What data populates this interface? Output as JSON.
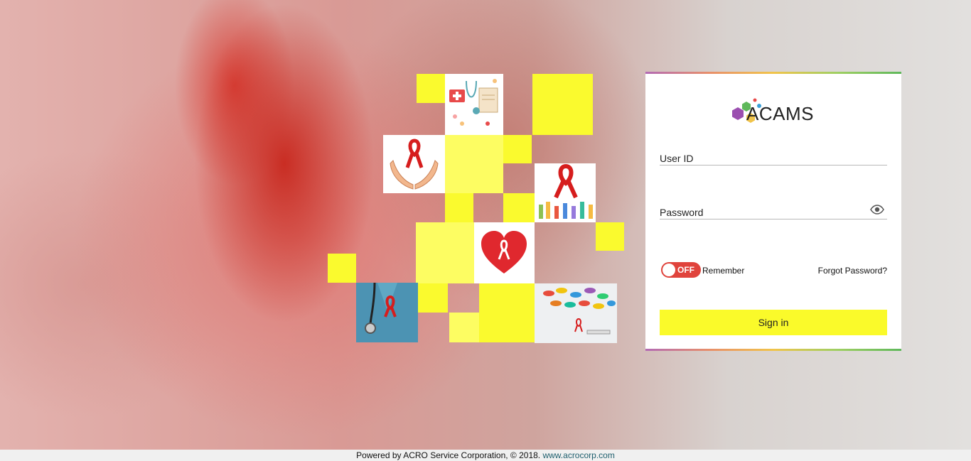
{
  "brand": {
    "logo_text": "ACAMS",
    "colors": {
      "accent": "#fafa2a",
      "toggle_off": "#e0433c",
      "link": "#1f5f6e"
    }
  },
  "login": {
    "user_id_label": "User ID",
    "password_label": "Password",
    "password_icon": "eye-icon",
    "toggle_text": "OFF",
    "remember_label": "Remember",
    "forgot_label": "Forgot Password?",
    "signin_label": "Sign in"
  },
  "footer": {
    "text": "Powered by ACRO Service Corporation, © 2018.",
    "link": "www.acrocorp.com"
  }
}
